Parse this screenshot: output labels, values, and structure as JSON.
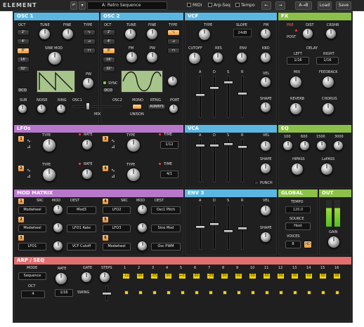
{
  "toolbar": {
    "logo": "ELEMENT",
    "preset": "A: Retro Sequence",
    "midi": "MIDI",
    "arp": "Arp-Seq",
    "tempo": "Tempo",
    "ab": "A→B",
    "load": "Load",
    "save": "Save"
  },
  "sections": {
    "osc1": "OSC 1",
    "osc2": "OSC 2",
    "vcf": "VCF",
    "fx": "FX",
    "lfos": "LFOs",
    "vca": "VCA",
    "eq": "EQ",
    "mod": "MOD MATRIX",
    "env3": "ENV 3",
    "global": "GLOBAL",
    "out": "OUT",
    "arp": "ARP / SEQ"
  },
  "osc1": {
    "oct": "OCT",
    "tune": "TUNE",
    "fine": "FINE",
    "type": "TYPE",
    "sinemod": "SINE MOD",
    "pw": "PW",
    "octaves": [
      "2'",
      "4'",
      "8'",
      "16'",
      "32'"
    ],
    "dco": "DCO"
  },
  "osc2": {
    "oct": "OCT",
    "tune": "TUNE",
    "fine": "FINE",
    "type": "TYPE",
    "fm": "FM",
    "sync": "SYNC",
    "pw": "PW",
    "octaves": [
      "2'",
      "4'",
      "8'",
      "16'",
      "32'"
    ],
    "dco": "DCO"
  },
  "mix": {
    "sub": "SUB",
    "noise": "NOISE",
    "ring": "RING",
    "osc1": "OSC1",
    "osc2": "OSC2",
    "mix": "MIX",
    "mono": "MONO",
    "unison": "UNISON",
    "rtrig": "RTRIG",
    "always": "ALWAYS",
    "port": "PORT"
  },
  "vcf": {
    "type": "TYPE",
    "slope": "SLOPE",
    "slopeval": "24dB",
    "cutoff": "CUTOFF",
    "res": "RES",
    "env": "ENV",
    "fm": "FM",
    "kbd": "KBD",
    "vel": "VEL",
    "shape": "SHAPE",
    "adsr": [
      "A",
      "D",
      "S",
      "R"
    ]
  },
  "fx": {
    "pre": "PRE",
    "dist": "DIST",
    "crshr": "CRSHR",
    "post": "POST",
    "delay": "DELAY",
    "left": "LEFT",
    "right": "RIGHT",
    "l16": "1/16",
    "r16": "1/16",
    "mix": "MIX",
    "feedback": "FEEDBACK",
    "reverb": "REVERB",
    "chorus": "CHORUS"
  },
  "lfo": {
    "type": "TYPE",
    "rate": "RATE",
    "time": "TIME",
    "t3": "1/12",
    "t4": "4/1",
    "n": [
      "1",
      "2",
      "3",
      "4"
    ]
  },
  "vca": {
    "vel": "VEL",
    "shape": "SHAPE",
    "punch": "PUNCH",
    "adsr": [
      "A",
      "D",
      "S",
      "R"
    ]
  },
  "eq": {
    "bands": [
      "100",
      "600",
      "1500",
      "3000"
    ],
    "hipass": "HIPASS",
    "lopass": "LoPASS"
  },
  "modm": {
    "src": "SRC",
    "mod": "MOD",
    "dest": "DEST",
    "rows": [
      {
        "n": "1",
        "src": "Modwheel",
        "dest": "Mod3"
      },
      {
        "n": "2",
        "src": "Modwheel",
        "dest": "LFO1 Rate"
      },
      {
        "n": "3",
        "src": "LFO1",
        "dest": "VCF Cutoff"
      },
      {
        "n": "4",
        "src": "LFO2",
        "dest": "Osc1 Pitch"
      },
      {
        "n": "5",
        "src": "LFO3",
        "dest": "Sine Mod"
      },
      {
        "n": "6",
        "src": "Modwheel",
        "dest": "Osc PWM"
      }
    ]
  },
  "env3": {
    "vel": "VEL",
    "shape": "SHAPE",
    "adsr": [
      "A",
      "D",
      "S",
      "R"
    ]
  },
  "global": {
    "tempo": "TEMPO",
    "tempoval": "120.0",
    "source": "SOURCE",
    "sourceval": "Host",
    "voices": "VOICES",
    "voicesval": "8",
    "hd": "HD",
    "gain": "GAIN"
  },
  "arp": {
    "mode": "MODE",
    "modeval": "Sequence",
    "oct": "OCT",
    "octval": "4",
    "rate": "RATE",
    "rateval": "1/16",
    "gate": "GATE",
    "steps": "STEPS",
    "swing": "SWING",
    "numbers": [
      "1",
      "2",
      "3",
      "4",
      "5",
      "6",
      "7",
      "8",
      "9",
      "10",
      "11",
      "12",
      "13",
      "14",
      "15",
      "16"
    ],
    "values": [
      "-12",
      "00",
      "-05",
      "00",
      "+03",
      "00",
      "-05",
      "00",
      "00",
      "00",
      "00",
      "00",
      "00",
      "00",
      "00",
      "00"
    ]
  },
  "colors": {
    "osc": "#59b6e0",
    "vcf": "#59b6e0",
    "fx": "#8cc04a",
    "lfo": "#b474c8",
    "vca": "#59b6e0",
    "eq": "#8cc04a",
    "mod": "#b474c8",
    "env": "#59b6e0",
    "global": "#8cc04a",
    "arp": "#e26d6d"
  }
}
